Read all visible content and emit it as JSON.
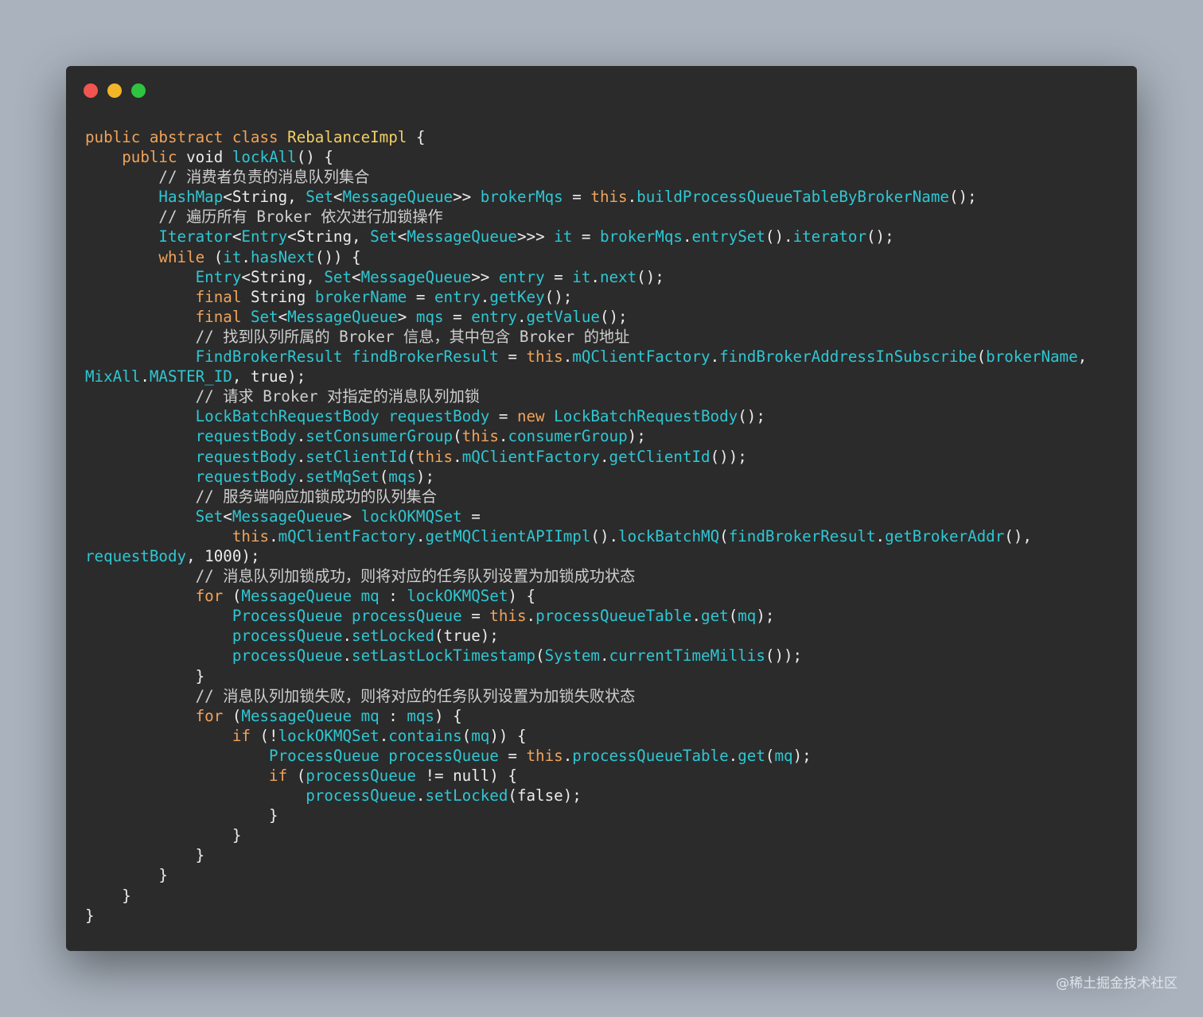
{
  "window": {
    "controls": [
      {
        "name": "close",
        "color": "#f2554f"
      },
      {
        "name": "minimize",
        "color": "#f4b428"
      },
      {
        "name": "maximize",
        "color": "#2ec43f"
      }
    ]
  },
  "code": {
    "language": "java",
    "lines": [
      [
        {
          "t": "kw",
          "v": "public abstract class "
        },
        {
          "t": "ty",
          "v": "RebalanceImpl"
        },
        {
          "t": "pl",
          "v": " {"
        }
      ],
      [
        {
          "t": "pl",
          "v": "    "
        },
        {
          "t": "kw",
          "v": "public "
        },
        {
          "t": "pl",
          "v": "void "
        },
        {
          "t": "id",
          "v": "lockAll"
        },
        {
          "t": "pl",
          "v": "() {"
        }
      ],
      [
        {
          "t": "cm",
          "v": "        // 消费者负责的消息队列集合"
        }
      ],
      [
        {
          "t": "pl",
          "v": "        "
        },
        {
          "t": "id",
          "v": "HashMap"
        },
        {
          "t": "pl",
          "v": "<String, "
        },
        {
          "t": "id",
          "v": "Set"
        },
        {
          "t": "pl",
          "v": "<"
        },
        {
          "t": "id",
          "v": "MessageQueue"
        },
        {
          "t": "pl",
          "v": ">> "
        },
        {
          "t": "id",
          "v": "brokerMqs"
        },
        {
          "t": "pl",
          "v": " = "
        },
        {
          "t": "kw",
          "v": "this"
        },
        {
          "t": "pl",
          "v": "."
        },
        {
          "t": "id",
          "v": "buildProcessQueueTableByBrokerName"
        },
        {
          "t": "pl",
          "v": "();"
        }
      ],
      [
        {
          "t": "cm",
          "v": "        // 遍历所有 Broker 依次进行加锁操作"
        }
      ],
      [
        {
          "t": "pl",
          "v": "        "
        },
        {
          "t": "id",
          "v": "Iterator"
        },
        {
          "t": "pl",
          "v": "<"
        },
        {
          "t": "id",
          "v": "Entry"
        },
        {
          "t": "pl",
          "v": "<String, "
        },
        {
          "t": "id",
          "v": "Set"
        },
        {
          "t": "pl",
          "v": "<"
        },
        {
          "t": "id",
          "v": "MessageQueue"
        },
        {
          "t": "pl",
          "v": ">>> "
        },
        {
          "t": "id",
          "v": "it"
        },
        {
          "t": "pl",
          "v": " = "
        },
        {
          "t": "id",
          "v": "brokerMqs"
        },
        {
          "t": "pl",
          "v": "."
        },
        {
          "t": "id",
          "v": "entrySet"
        },
        {
          "t": "pl",
          "v": "()."
        },
        {
          "t": "id",
          "v": "iterator"
        },
        {
          "t": "pl",
          "v": "();"
        }
      ],
      [
        {
          "t": "pl",
          "v": "        "
        },
        {
          "t": "kw",
          "v": "while"
        },
        {
          "t": "pl",
          "v": " ("
        },
        {
          "t": "id",
          "v": "it"
        },
        {
          "t": "pl",
          "v": "."
        },
        {
          "t": "id",
          "v": "hasNext"
        },
        {
          "t": "pl",
          "v": "()) {"
        }
      ],
      [
        {
          "t": "pl",
          "v": "            "
        },
        {
          "t": "id",
          "v": "Entry"
        },
        {
          "t": "pl",
          "v": "<String, "
        },
        {
          "t": "id",
          "v": "Set"
        },
        {
          "t": "pl",
          "v": "<"
        },
        {
          "t": "id",
          "v": "MessageQueue"
        },
        {
          "t": "pl",
          "v": ">> "
        },
        {
          "t": "id",
          "v": "entry"
        },
        {
          "t": "pl",
          "v": " = "
        },
        {
          "t": "id",
          "v": "it"
        },
        {
          "t": "pl",
          "v": "."
        },
        {
          "t": "id",
          "v": "next"
        },
        {
          "t": "pl",
          "v": "();"
        }
      ],
      [
        {
          "t": "pl",
          "v": "            "
        },
        {
          "t": "kw",
          "v": "final "
        },
        {
          "t": "pl",
          "v": "String "
        },
        {
          "t": "id",
          "v": "brokerName"
        },
        {
          "t": "pl",
          "v": " = "
        },
        {
          "t": "id",
          "v": "entry"
        },
        {
          "t": "pl",
          "v": "."
        },
        {
          "t": "id",
          "v": "getKey"
        },
        {
          "t": "pl",
          "v": "();"
        }
      ],
      [
        {
          "t": "pl",
          "v": "            "
        },
        {
          "t": "kw",
          "v": "final "
        },
        {
          "t": "id",
          "v": "Set"
        },
        {
          "t": "pl",
          "v": "<"
        },
        {
          "t": "id",
          "v": "MessageQueue"
        },
        {
          "t": "pl",
          "v": "> "
        },
        {
          "t": "id",
          "v": "mqs"
        },
        {
          "t": "pl",
          "v": " = "
        },
        {
          "t": "id",
          "v": "entry"
        },
        {
          "t": "pl",
          "v": "."
        },
        {
          "t": "id",
          "v": "getValue"
        },
        {
          "t": "pl",
          "v": "();"
        }
      ],
      [
        {
          "t": "cm",
          "v": "            // 找到队列所属的 Broker 信息，其中包含 Broker 的地址"
        }
      ],
      [
        {
          "t": "pl",
          "v": "            "
        },
        {
          "t": "id",
          "v": "FindBrokerResult findBrokerResult"
        },
        {
          "t": "pl",
          "v": " = "
        },
        {
          "t": "kw",
          "v": "this"
        },
        {
          "t": "pl",
          "v": "."
        },
        {
          "t": "id",
          "v": "mQClientFactory"
        },
        {
          "t": "pl",
          "v": "."
        },
        {
          "t": "id",
          "v": "findBrokerAddressInSubscribe"
        },
        {
          "t": "pl",
          "v": "("
        },
        {
          "t": "id",
          "v": "brokerName"
        },
        {
          "t": "pl",
          "v": ","
        }
      ],
      [
        {
          "t": "id",
          "v": "MixAll"
        },
        {
          "t": "pl",
          "v": "."
        },
        {
          "t": "id",
          "v": "MASTER_ID"
        },
        {
          "t": "pl",
          "v": ", true);"
        }
      ],
      [
        {
          "t": "cm",
          "v": "            // 请求 Broker 对指定的消息队列加锁"
        }
      ],
      [
        {
          "t": "pl",
          "v": "            "
        },
        {
          "t": "id",
          "v": "LockBatchRequestBody requestBody"
        },
        {
          "t": "pl",
          "v": " = "
        },
        {
          "t": "kw",
          "v": "new "
        },
        {
          "t": "id",
          "v": "LockBatchRequestBody"
        },
        {
          "t": "pl",
          "v": "();"
        }
      ],
      [
        {
          "t": "pl",
          "v": "            "
        },
        {
          "t": "id",
          "v": "requestBody"
        },
        {
          "t": "pl",
          "v": "."
        },
        {
          "t": "id",
          "v": "setConsumerGroup"
        },
        {
          "t": "pl",
          "v": "("
        },
        {
          "t": "kw",
          "v": "this"
        },
        {
          "t": "pl",
          "v": "."
        },
        {
          "t": "id",
          "v": "consumerGroup"
        },
        {
          "t": "pl",
          "v": ");"
        }
      ],
      [
        {
          "t": "pl",
          "v": "            "
        },
        {
          "t": "id",
          "v": "requestBody"
        },
        {
          "t": "pl",
          "v": "."
        },
        {
          "t": "id",
          "v": "setClientId"
        },
        {
          "t": "pl",
          "v": "("
        },
        {
          "t": "kw",
          "v": "this"
        },
        {
          "t": "pl",
          "v": "."
        },
        {
          "t": "id",
          "v": "mQClientFactory"
        },
        {
          "t": "pl",
          "v": "."
        },
        {
          "t": "id",
          "v": "getClientId"
        },
        {
          "t": "pl",
          "v": "());"
        }
      ],
      [
        {
          "t": "pl",
          "v": "            "
        },
        {
          "t": "id",
          "v": "requestBody"
        },
        {
          "t": "pl",
          "v": "."
        },
        {
          "t": "id",
          "v": "setMqSet"
        },
        {
          "t": "pl",
          "v": "("
        },
        {
          "t": "id",
          "v": "mqs"
        },
        {
          "t": "pl",
          "v": ");"
        }
      ],
      [
        {
          "t": "cm",
          "v": "            // 服务端响应加锁成功的队列集合"
        }
      ],
      [
        {
          "t": "pl",
          "v": "            "
        },
        {
          "t": "id",
          "v": "Set"
        },
        {
          "t": "pl",
          "v": "<"
        },
        {
          "t": "id",
          "v": "MessageQueue"
        },
        {
          "t": "pl",
          "v": "> "
        },
        {
          "t": "id",
          "v": "lockOKMQSet"
        },
        {
          "t": "pl",
          "v": " ="
        }
      ],
      [
        {
          "t": "pl",
          "v": "                "
        },
        {
          "t": "kw",
          "v": "this"
        },
        {
          "t": "pl",
          "v": "."
        },
        {
          "t": "id",
          "v": "mQClientFactory"
        },
        {
          "t": "pl",
          "v": "."
        },
        {
          "t": "id",
          "v": "getMQClientAPIImpl"
        },
        {
          "t": "pl",
          "v": "()."
        },
        {
          "t": "id",
          "v": "lockBatchMQ"
        },
        {
          "t": "pl",
          "v": "("
        },
        {
          "t": "id",
          "v": "findBrokerResult"
        },
        {
          "t": "pl",
          "v": "."
        },
        {
          "t": "id",
          "v": "getBrokerAddr"
        },
        {
          "t": "pl",
          "v": "(),"
        }
      ],
      [
        {
          "t": "id",
          "v": "requestBody"
        },
        {
          "t": "pl",
          "v": ", 1000);"
        }
      ],
      [
        {
          "t": "cm",
          "v": "            // 消息队列加锁成功，则将对应的任务队列设置为加锁成功状态"
        }
      ],
      [
        {
          "t": "pl",
          "v": "            "
        },
        {
          "t": "kw",
          "v": "for"
        },
        {
          "t": "pl",
          "v": " ("
        },
        {
          "t": "id",
          "v": "MessageQueue mq"
        },
        {
          "t": "pl",
          "v": " : "
        },
        {
          "t": "id",
          "v": "lockOKMQSet"
        },
        {
          "t": "pl",
          "v": ") {"
        }
      ],
      [
        {
          "t": "pl",
          "v": "                "
        },
        {
          "t": "id",
          "v": "ProcessQueue processQueue"
        },
        {
          "t": "pl",
          "v": " = "
        },
        {
          "t": "kw",
          "v": "this"
        },
        {
          "t": "pl",
          "v": "."
        },
        {
          "t": "id",
          "v": "processQueueTable"
        },
        {
          "t": "pl",
          "v": "."
        },
        {
          "t": "id",
          "v": "get"
        },
        {
          "t": "pl",
          "v": "("
        },
        {
          "t": "id",
          "v": "mq"
        },
        {
          "t": "pl",
          "v": ");"
        }
      ],
      [
        {
          "t": "pl",
          "v": "                "
        },
        {
          "t": "id",
          "v": "processQueue"
        },
        {
          "t": "pl",
          "v": "."
        },
        {
          "t": "id",
          "v": "setLocked"
        },
        {
          "t": "pl",
          "v": "(true);"
        }
      ],
      [
        {
          "t": "pl",
          "v": "                "
        },
        {
          "t": "id",
          "v": "processQueue"
        },
        {
          "t": "pl",
          "v": "."
        },
        {
          "t": "id",
          "v": "setLastLockTimestamp"
        },
        {
          "t": "pl",
          "v": "("
        },
        {
          "t": "id",
          "v": "System"
        },
        {
          "t": "pl",
          "v": "."
        },
        {
          "t": "id",
          "v": "currentTimeMillis"
        },
        {
          "t": "pl",
          "v": "());"
        }
      ],
      [
        {
          "t": "pl",
          "v": "            }"
        }
      ],
      [
        {
          "t": "cm",
          "v": "            // 消息队列加锁失败，则将对应的任务队列设置为加锁失败状态"
        }
      ],
      [
        {
          "t": "pl",
          "v": "            "
        },
        {
          "t": "kw",
          "v": "for"
        },
        {
          "t": "pl",
          "v": " ("
        },
        {
          "t": "id",
          "v": "MessageQueue mq"
        },
        {
          "t": "pl",
          "v": " : "
        },
        {
          "t": "id",
          "v": "mqs"
        },
        {
          "t": "pl",
          "v": ") {"
        }
      ],
      [
        {
          "t": "pl",
          "v": "                "
        },
        {
          "t": "kw",
          "v": "if"
        },
        {
          "t": "pl",
          "v": " (!"
        },
        {
          "t": "id",
          "v": "lockOKMQSet"
        },
        {
          "t": "pl",
          "v": "."
        },
        {
          "t": "id",
          "v": "contains"
        },
        {
          "t": "pl",
          "v": "("
        },
        {
          "t": "id",
          "v": "mq"
        },
        {
          "t": "pl",
          "v": ")) {"
        }
      ],
      [
        {
          "t": "pl",
          "v": "                    "
        },
        {
          "t": "id",
          "v": "ProcessQueue processQueue"
        },
        {
          "t": "pl",
          "v": " = "
        },
        {
          "t": "kw",
          "v": "this"
        },
        {
          "t": "pl",
          "v": "."
        },
        {
          "t": "id",
          "v": "processQueueTable"
        },
        {
          "t": "pl",
          "v": "."
        },
        {
          "t": "id",
          "v": "get"
        },
        {
          "t": "pl",
          "v": "("
        },
        {
          "t": "id",
          "v": "mq"
        },
        {
          "t": "pl",
          "v": ");"
        }
      ],
      [
        {
          "t": "pl",
          "v": "                    "
        },
        {
          "t": "kw",
          "v": "if"
        },
        {
          "t": "pl",
          "v": " ("
        },
        {
          "t": "id",
          "v": "processQueue"
        },
        {
          "t": "pl",
          "v": " != null) {"
        }
      ],
      [
        {
          "t": "pl",
          "v": "                        "
        },
        {
          "t": "id",
          "v": "processQueue"
        },
        {
          "t": "pl",
          "v": "."
        },
        {
          "t": "id",
          "v": "setLocked"
        },
        {
          "t": "pl",
          "v": "(false);"
        }
      ],
      [
        {
          "t": "pl",
          "v": "                    }"
        }
      ],
      [
        {
          "t": "pl",
          "v": "                }"
        }
      ],
      [
        {
          "t": "pl",
          "v": "            }"
        }
      ],
      [
        {
          "t": "pl",
          "v": "        }"
        }
      ],
      [
        {
          "t": "pl",
          "v": "    }"
        }
      ],
      [
        {
          "t": "pl",
          "v": "}"
        }
      ]
    ]
  },
  "watermark": "@稀土掘金技术社区"
}
